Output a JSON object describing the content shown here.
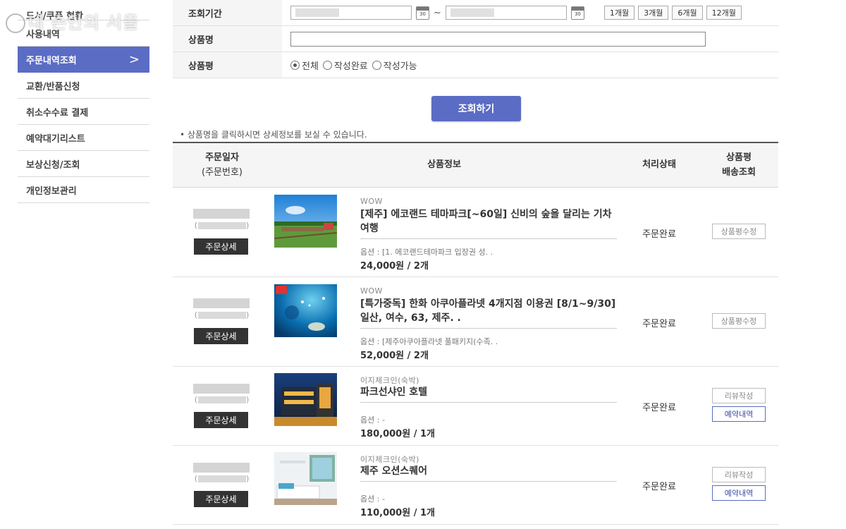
{
  "sidebar": {
    "items": [
      {
        "label": "도서/쿠폰 현황"
      },
      {
        "label": "사용내역"
      },
      {
        "label": "주문내역조회"
      },
      {
        "label": "교환/반품신청"
      },
      {
        "label": "취소수수료 결제"
      },
      {
        "label": "예약대기리스트"
      },
      {
        "label": "보상신청/조회"
      },
      {
        "label": "개인정보관리"
      }
    ],
    "active_chevron": ">",
    "watermark": "내 손안의 서울"
  },
  "search": {
    "period_label": "조회기간",
    "tilde": "~",
    "calendar_day": "30",
    "period_buttons": [
      "1개월",
      "3개월",
      "6개월",
      "12개월"
    ],
    "product_name_label": "상품명",
    "review_label": "상품평",
    "radios": [
      {
        "label": "전체",
        "selected": true
      },
      {
        "label": "작성완료",
        "selected": false
      },
      {
        "label": "작성가능",
        "selected": false
      }
    ],
    "submit_label": "조회하기",
    "notice": "• 상품명을 클릭하시면 상세정보를 보실 수 있습니다."
  },
  "table": {
    "headers": {
      "date_line1": "주문일자",
      "date_line2": "(주문번호)",
      "info": "상품정보",
      "status": "처리상태",
      "review_line1": "상품평",
      "review_line2": "배송조회"
    },
    "rows": [
      {
        "detail_label": "주문상세",
        "seller": "WOW",
        "name": "[제주] 에코랜드 테마파크[~60일] 신비의 숲을 달리는 기차여행",
        "option": "옵션 : [1. 에코랜드테마파크 입장권 성. .",
        "price": "24,000원   / 2개",
        "status": "주문완료",
        "buttons": [
          {
            "label": "상품평수정",
            "style": "gray"
          }
        ],
        "thumb": "ecoland-train"
      },
      {
        "detail_label": "주문상세",
        "seller": "WOW",
        "name": "[특가중독] 한화 아쿠아플라넷 4개지점 이용권 [8/1~9/30] 일산, 여수, 63, 제주. .",
        "option": "옵션 : [제주아쿠아플라넷 풀패키지(수족. .",
        "price": "52,000원   / 2개",
        "status": "주문완료",
        "buttons": [
          {
            "label": "상품평수정",
            "style": "gray"
          }
        ],
        "thumb": "aquarium"
      },
      {
        "detail_label": "주문상세",
        "seller": "이지체크인(숙박)",
        "name": "파크선샤인 호텔",
        "option": "옵션 : -",
        "price": "180,000원   / 1개",
        "status": "주문완료",
        "buttons": [
          {
            "label": "리뷰작성",
            "style": "gray"
          },
          {
            "label": "예약내역",
            "style": "blue"
          }
        ],
        "thumb": "hotel-night"
      },
      {
        "detail_label": "주문상세",
        "seller": "이지체크인(숙박)",
        "name": "제주 오션스퀘어",
        "option": "옵션 : -",
        "price": "110,000원   / 1개",
        "status": "주문완료",
        "buttons": [
          {
            "label": "리뷰작성",
            "style": "gray"
          },
          {
            "label": "예약내역",
            "style": "blue"
          }
        ],
        "thumb": "hotel-room"
      }
    ]
  }
}
